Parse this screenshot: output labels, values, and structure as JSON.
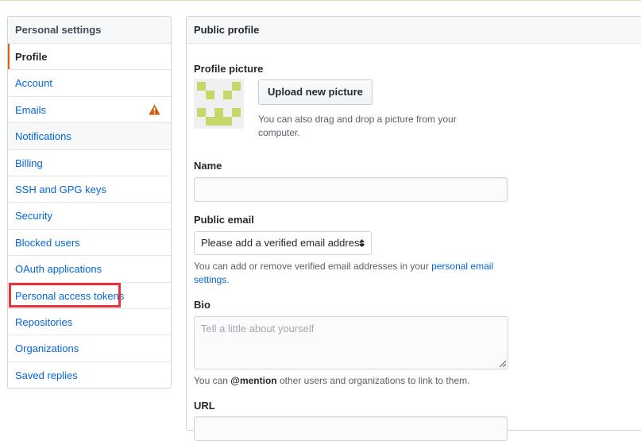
{
  "sidebar": {
    "title": "Personal settings",
    "items": [
      {
        "label": "Profile"
      },
      {
        "label": "Account"
      },
      {
        "label": "Emails"
      },
      {
        "label": "Notifications"
      },
      {
        "label": "Billing"
      },
      {
        "label": "SSH and GPG keys"
      },
      {
        "label": "Security"
      },
      {
        "label": "Blocked users"
      },
      {
        "label": "OAuth applications"
      },
      {
        "label": "Personal access tokens"
      },
      {
        "label": "Repositories"
      },
      {
        "label": "Organizations"
      },
      {
        "label": "Saved replies"
      }
    ],
    "selected": "Profile",
    "emails_icon": "warning-icon"
  },
  "main": {
    "title": "Public profile",
    "profile_picture": {
      "label": "Profile picture",
      "upload_button": "Upload new picture",
      "hint": "You can also drag and drop a picture from your computer."
    },
    "name": {
      "label": "Name",
      "value": ""
    },
    "public_email": {
      "label": "Public email",
      "selected": "Please add a verified email address",
      "hint_prefix": "You can add or remove verified email addresses in your ",
      "hint_link": "personal email settings",
      "hint_suffix": "."
    },
    "bio": {
      "label": "Bio",
      "placeholder": "Tell a little about yourself",
      "hint_prefix": "You can ",
      "hint_mention": "@mention",
      "hint_suffix": " other users and organizations to link to them."
    },
    "url": {
      "label": "URL"
    }
  },
  "colors": {
    "link": "#0366d6",
    "selected_marker": "#e36209",
    "warning": "#d15704",
    "highlight": "#e8323c",
    "avatar": "#c5d96b"
  }
}
